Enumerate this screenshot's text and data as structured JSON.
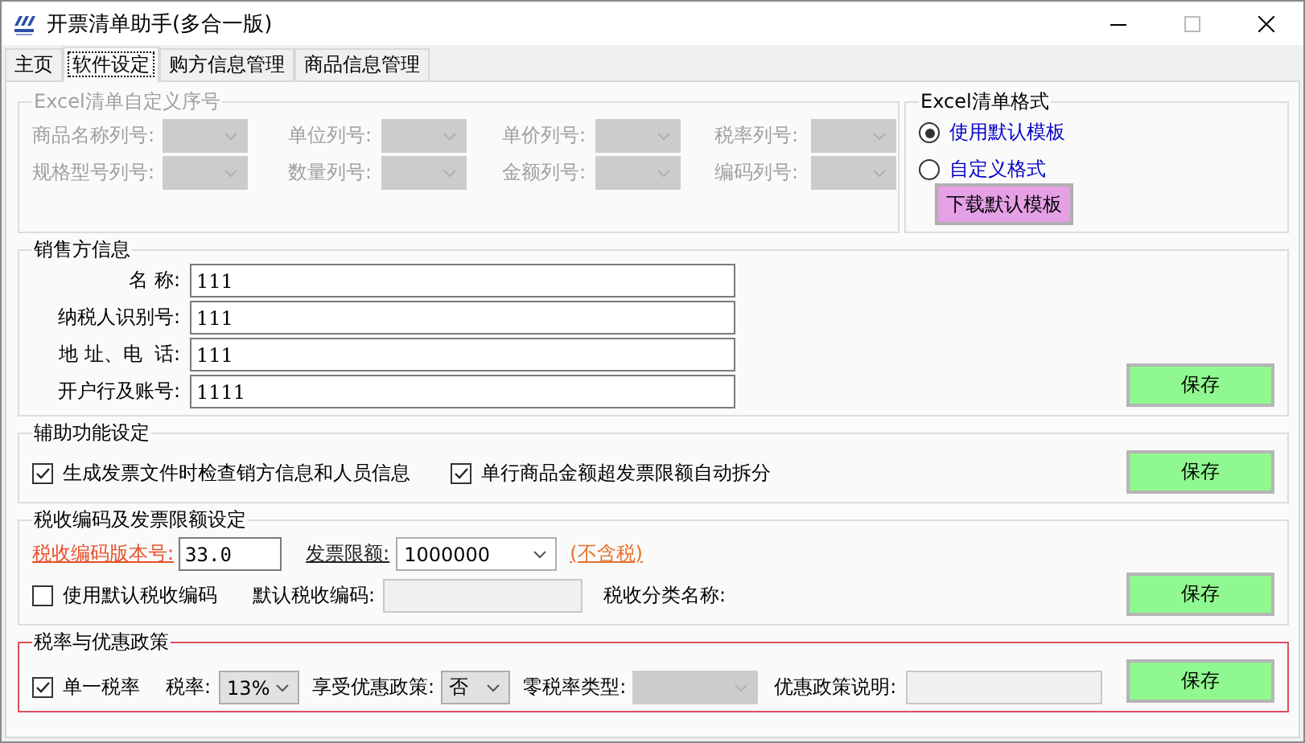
{
  "window": {
    "title": "开票清单助手(多合一版)"
  },
  "tabs": [
    {
      "label": "主页",
      "selected": false
    },
    {
      "label": "软件设定",
      "selected": true
    },
    {
      "label": "购方信息管理",
      "selected": false
    },
    {
      "label": "商品信息管理",
      "selected": false
    }
  ],
  "excel_column_settings": {
    "title": "Excel清单自定义序号",
    "disabled": true,
    "fields": [
      {
        "label": "商品名称列号:"
      },
      {
        "label": "单位列号:"
      },
      {
        "label": "单价列号:"
      },
      {
        "label": "税率列号:"
      },
      {
        "label": "规格型号列号:"
      },
      {
        "label": "数量列号:"
      },
      {
        "label": "金额列号:"
      },
      {
        "label": "编码列号:"
      }
    ]
  },
  "excel_format": {
    "title": "Excel清单格式",
    "options": [
      {
        "label": "使用默认模板",
        "selected": true
      },
      {
        "label": "自定义格式",
        "selected": false
      }
    ],
    "download_button": "下载默认模板"
  },
  "seller_info": {
    "title": "销售方信息",
    "fields": [
      {
        "label": "名 称:",
        "value": "111"
      },
      {
        "label": "纳税人识别号:",
        "value": "111"
      },
      {
        "label": "地 址、电  话:",
        "value": "111"
      },
      {
        "label": "开户行及账号:",
        "value": "1111"
      }
    ],
    "save_button": "保存"
  },
  "auxiliary": {
    "title": "辅助功能设定",
    "checkboxes": [
      {
        "label": "生成发票文件时检查销方信息和人员信息",
        "checked": true
      },
      {
        "label": "单行商品金额超发票限额自动拆分",
        "checked": true
      }
    ],
    "save_button": "保存"
  },
  "tax_code": {
    "title": "税收编码及发票限额设定",
    "version_label": "税收编码版本号:",
    "version_value": "33.0",
    "limit_label": "发票限额:",
    "limit_value": "1000000",
    "limit_note": "(不含税)",
    "use_default": {
      "label": "使用默认税收编码",
      "checked": false
    },
    "default_code_label": "默认税收编码:",
    "category_label": "税收分类名称:",
    "save_button": "保存"
  },
  "tax_rate": {
    "title": "税率与优惠政策",
    "single_rate": {
      "label": "单一税率",
      "checked": true
    },
    "rate_label": "税率:",
    "rate_value": "13%",
    "policy_label": "享受优惠政策:",
    "policy_value": "否",
    "zero_rate_label": "零税率类型:",
    "policy_note_label": "优惠政策说明:",
    "save_button": "保存"
  }
}
